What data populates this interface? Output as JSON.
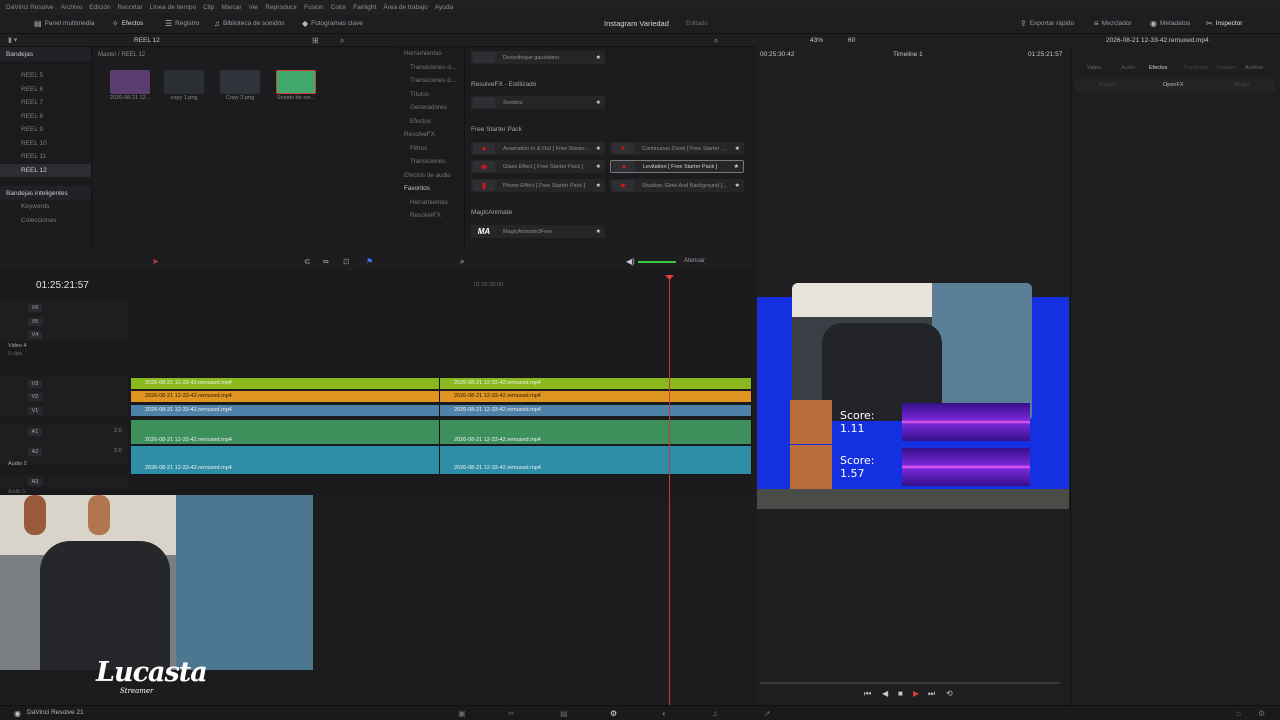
{
  "menu": [
    "DaVinci Resolve",
    "Archivo",
    "Edición",
    "Recortar",
    "Línea de tiempo",
    "Clip",
    "Marcar",
    "Ver",
    "Reproducir",
    "Fusion",
    "Color",
    "Fairlight",
    "Área de trabajo",
    "Ayuda"
  ],
  "toolbar": {
    "media_pool": "Panel multimedia",
    "effects": "Efectos",
    "index": "Registro",
    "sound_library": "Biblioteca de sonidos",
    "keyframes": "Fotogramas clave",
    "project_title": "Instagram Variedad",
    "project_status": "Editado",
    "quick_export": "Exportar rápido",
    "mixer": "Mezclador",
    "metadata": "Metadatos",
    "inspector": "Inspector"
  },
  "pool": {
    "reel": "REEL 12",
    "path": "Master / REEL 12",
    "zoom": "43%",
    "fps": "60",
    "timecode_left": "00:25:30:42",
    "timeline_name": "Timeline 1",
    "timecode_right": "01:25:21:57",
    "clip_name": "2026-08-21 12-33-42.remuxed.mp4"
  },
  "bins": {
    "header": "Bandejas",
    "items": [
      "REEL 5",
      "REEL 6",
      "REEL 7",
      "REEL 8",
      "REEL 9",
      "REEL 10",
      "REEL 11",
      "REEL 12"
    ],
    "smart_header": "Bandejas inteligentes",
    "smart_items": [
      "Keywords",
      "Colecciones"
    ]
  },
  "media": [
    {
      "label": "2026-08-21 12...",
      "color": "#5a3d6e"
    },
    {
      "label": "copy 1.png",
      "color": "#2b2f34"
    },
    {
      "label": "Copy 2.png",
      "color": "#30343a"
    },
    {
      "label": "Sonido de sor...",
      "color": "#3fa86a"
    }
  ],
  "fxtree": [
    "Herramientas",
    "Transiciones d...",
    "Transiciones d...",
    "Títulos",
    "Generadores",
    "Efectos",
    "ResolveFX",
    "Filtros",
    "Transiciones",
    "Efectos de audio",
    "Favoritos",
    "Herramientas",
    "ResolveFX"
  ],
  "fxlist": {
    "blur": "Desenfoque gaussiano",
    "stylize_section": "ResolveFX - Estilizado",
    "shadow": "Sombra",
    "pack_section": "Free Starter Pack",
    "items": [
      "Anamation In & Out [ Free Starter...",
      "Glass Effect [ Free Starter Pack ]",
      "Phone Effect [ Free Starter Pack ]",
      "Continuous Zoom [ Free Starter ...",
      "Levitation [ Free Starter Pack ]",
      "Shadow, Glow And Background [..."
    ],
    "magic_section": "MagicAnimate",
    "magic_item": "MagicAnimate3Free"
  },
  "timeline": {
    "timecode": "01:25:21:57",
    "ruler_mark": "01:25:20:00",
    "attenuate": "Atenuar",
    "video4": "Video 4",
    "video4_sub": "5 clips",
    "audio2": "Audio 2",
    "audio3": "Audio 3",
    "tracks": [
      "V6",
      "V5",
      "V4",
      "V3",
      "V2",
      "V1",
      "A1",
      "A2",
      "A3"
    ],
    "level": "2.0",
    "clip": "2026-08-21 12-33-42.remuxed.mp4"
  },
  "viewer": {
    "scores": [
      "Score: 1.11",
      "Score: 1.57"
    ]
  },
  "inspector_tabs": [
    "Video",
    "Audio",
    "Efectos",
    "Transición",
    "Imagen",
    "Archivo"
  ],
  "inspector_subtabs": [
    "Fusion",
    "OpenFX",
    "Audio"
  ],
  "brand": {
    "name": "DaVinci Resolve 21",
    "logo": "Lucasta",
    "logo_sub": "Streamer"
  },
  "colors": {
    "accent_red": "#c83a3a",
    "canvas_blue": "#1430e0",
    "clip_green": "#8ab81f",
    "clip_orange": "#e09422"
  }
}
